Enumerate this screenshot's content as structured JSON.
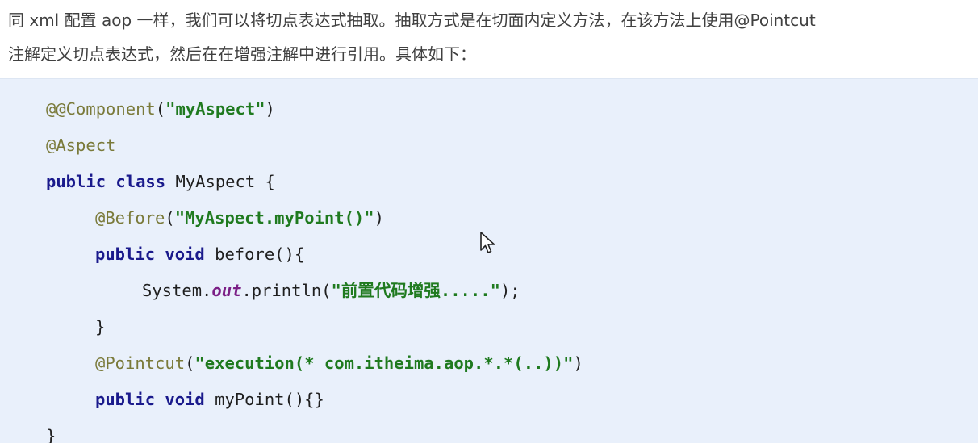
{
  "intro": {
    "line1": "同 xml 配置 aop 一样，我们可以将切点表达式抽取。抽取方式是在切面内定义方法，在该方法上使用@Pointcut",
    "line2": "注解定义切点表达式，然后在在增强注解中进行引用。具体如下："
  },
  "code": {
    "l1": {
      "ann": "@@Component",
      "open": "(",
      "str": "\"myAspect\"",
      "close": ")"
    },
    "l2": {
      "ann": "@Aspect"
    },
    "l3": {
      "kw": "public class",
      "rest": " MyAspect {"
    },
    "l4": {
      "ann": "@Before",
      "open": "(",
      "str": "\"MyAspect.myPoint()\"",
      "close": ")"
    },
    "l5": {
      "kw": "public void",
      "rest": " before(){"
    },
    "l6": {
      "pre": "System.",
      "fld": "out",
      "mid": ".println(",
      "str": "\"前置代码增强.....\"",
      "post": ");"
    },
    "l7": {
      "rest": "}"
    },
    "l8": {
      "ann": "@Pointcut",
      "open": "(",
      "str": "\"execution(* com.itheima.aop.*.*(..))\"",
      "close": ")"
    },
    "l9": {
      "kw": "public void",
      "rest": " myPoint(){}"
    },
    "l10": {
      "rest": "}"
    }
  },
  "icons": {
    "cursor": "mouse-pointer-icon"
  }
}
